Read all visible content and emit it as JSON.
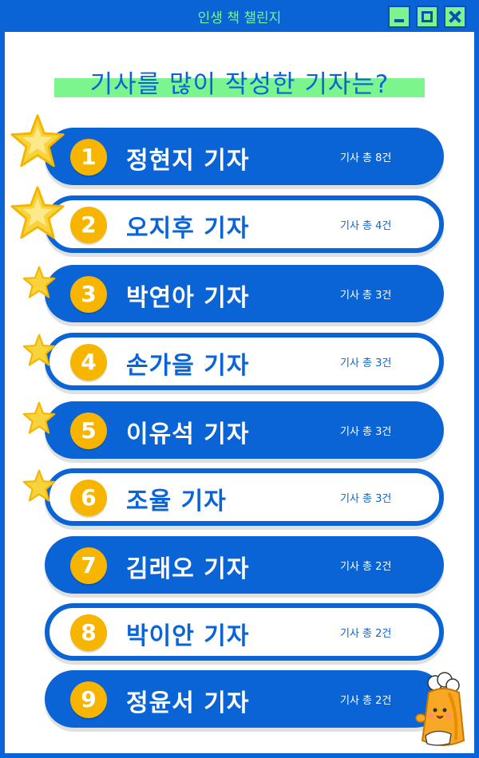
{
  "window": {
    "title": "인생 책 챌린지",
    "controls": [
      "minimize",
      "maximize",
      "close"
    ]
  },
  "headline": "기사를 많이 작성한 기자는?",
  "colors": {
    "brand_blue": "#0a64d6",
    "accent_green": "#7cf58f",
    "rank_badge": "#f7b500",
    "star": "#f9d33b"
  },
  "ranking": [
    {
      "rank": "1",
      "name": "정현지 기자",
      "count": "기사 총 8건"
    },
    {
      "rank": "2",
      "name": "오지후 기자",
      "count": "기사 총 4건"
    },
    {
      "rank": "3",
      "name": "박연아 기자",
      "count": "기사 총 3건"
    },
    {
      "rank": "4",
      "name": "손가을 기자",
      "count": "기사 총 3건"
    },
    {
      "rank": "5",
      "name": "이유석 기자",
      "count": "기사 총 3건"
    },
    {
      "rank": "6",
      "name": "조율 기자",
      "count": "기사 총 3건"
    },
    {
      "rank": "7",
      "name": "김래오 기자",
      "count": "기사 총 2건"
    },
    {
      "rank": "8",
      "name": "박이안 기자",
      "count": "기사 총 2건"
    },
    {
      "rank": "9",
      "name": "정윤서 기자",
      "count": "기사 총 2건"
    }
  ],
  "icons": {
    "star": "star-icon",
    "mascot": "mascot-illustration"
  }
}
